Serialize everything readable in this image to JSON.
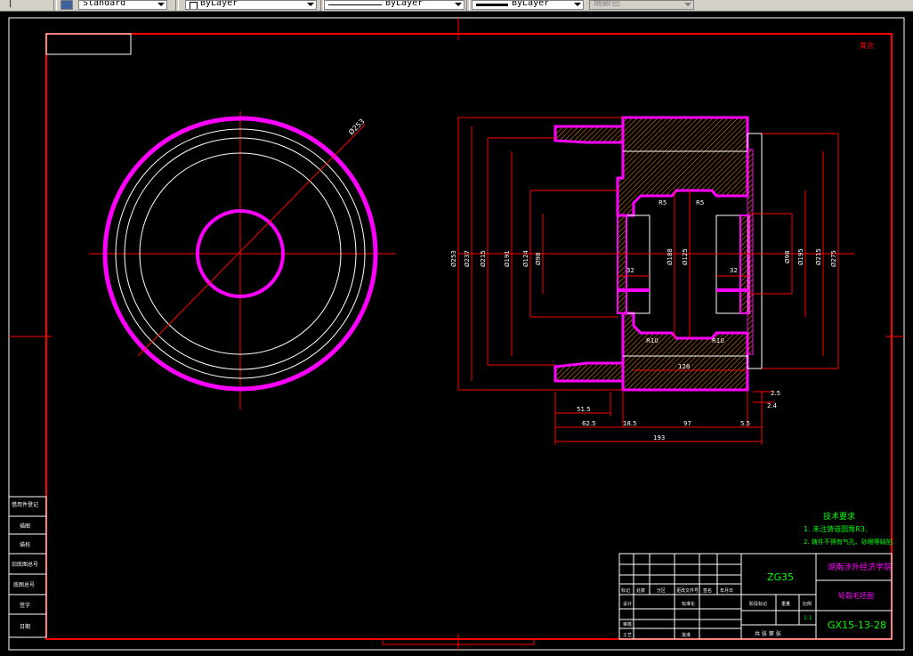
{
  "toolbar": {
    "left_clip": "|",
    "text_style": "Standard",
    "layer": "ByLayer",
    "linetype": "ByLayer",
    "lineweight": "ByLayer",
    "color": "随颜色"
  },
  "drawing": {
    "roughness_mark": "其余",
    "left_view": {
      "dia_label": "Ø253"
    },
    "section_view": {
      "dims_left": [
        "Ø253",
        "Ø237",
        "Ø215",
        "Ø191",
        "Ø124",
        "Ø98"
      ],
      "dims_center": [
        "Ø188",
        "Ø125"
      ],
      "dims_right": [
        "Ø98",
        "Ø195",
        "Ø215",
        "Ø275"
      ],
      "r_labels": [
        "R5",
        "R5",
        "R10",
        "R10"
      ],
      "dim_32_left": "32",
      "dim_32_right": "32",
      "dim_128": "128",
      "dim_2_5": "2.5",
      "dim_2_4": "2.4",
      "dim_51_5": "51.5",
      "dim_18_5": "18.5",
      "dim_97": "97",
      "dim_5_5": "5.5",
      "dim_62_5": "62.5",
      "dim_193": "193"
    },
    "tech_req": {
      "title": "技术要求",
      "line1": "1. 未注铸造圆角R3.",
      "line2": "2. 铸件不得有气孔、砂眼等缺陷."
    },
    "title_block": {
      "material": "ZG35",
      "school": "湖南涉外经济学院",
      "part_name": "轮毂毛坯图",
      "drawing_no": "GX15-13-28",
      "scale": "1:1",
      "sheet_info": "共 张 第 张",
      "rows": [
        "标记",
        "处数",
        "分区",
        "更改文件号",
        "签名",
        "年月日"
      ],
      "designer": "设计",
      "standardized": "标准化",
      "stage": "阶段标记",
      "weight": "重量",
      "ratio": "比例",
      "reviewer": "审核",
      "process": "工艺",
      "approve": "批准"
    },
    "side_labels": [
      "借用件登记",
      "描图",
      "描校",
      "旧底图总号",
      "底图总号",
      "签字",
      "日期"
    ]
  },
  "colors": {
    "frame": "#ff0000",
    "geometry": "#ffffff",
    "hatch": "#ff00ff",
    "green_text": "#00ff00"
  }
}
